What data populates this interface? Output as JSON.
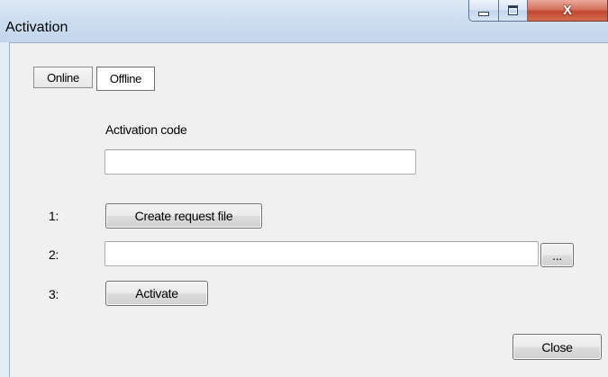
{
  "window": {
    "title": "Activation",
    "close_glyph": "X"
  },
  "tabs": [
    {
      "label": "Online",
      "selected": false
    },
    {
      "label": "Offline",
      "selected": true
    }
  ],
  "offline": {
    "activation_code_label": "Activation code",
    "activation_code_value": "",
    "steps": [
      {
        "number": "1:",
        "button_label": "Create request file"
      },
      {
        "number": "2:",
        "file_path_value": "",
        "browse_label": "..."
      },
      {
        "number": "3:",
        "button_label": "Activate"
      }
    ]
  },
  "footer": {
    "close_label": "Close"
  }
}
